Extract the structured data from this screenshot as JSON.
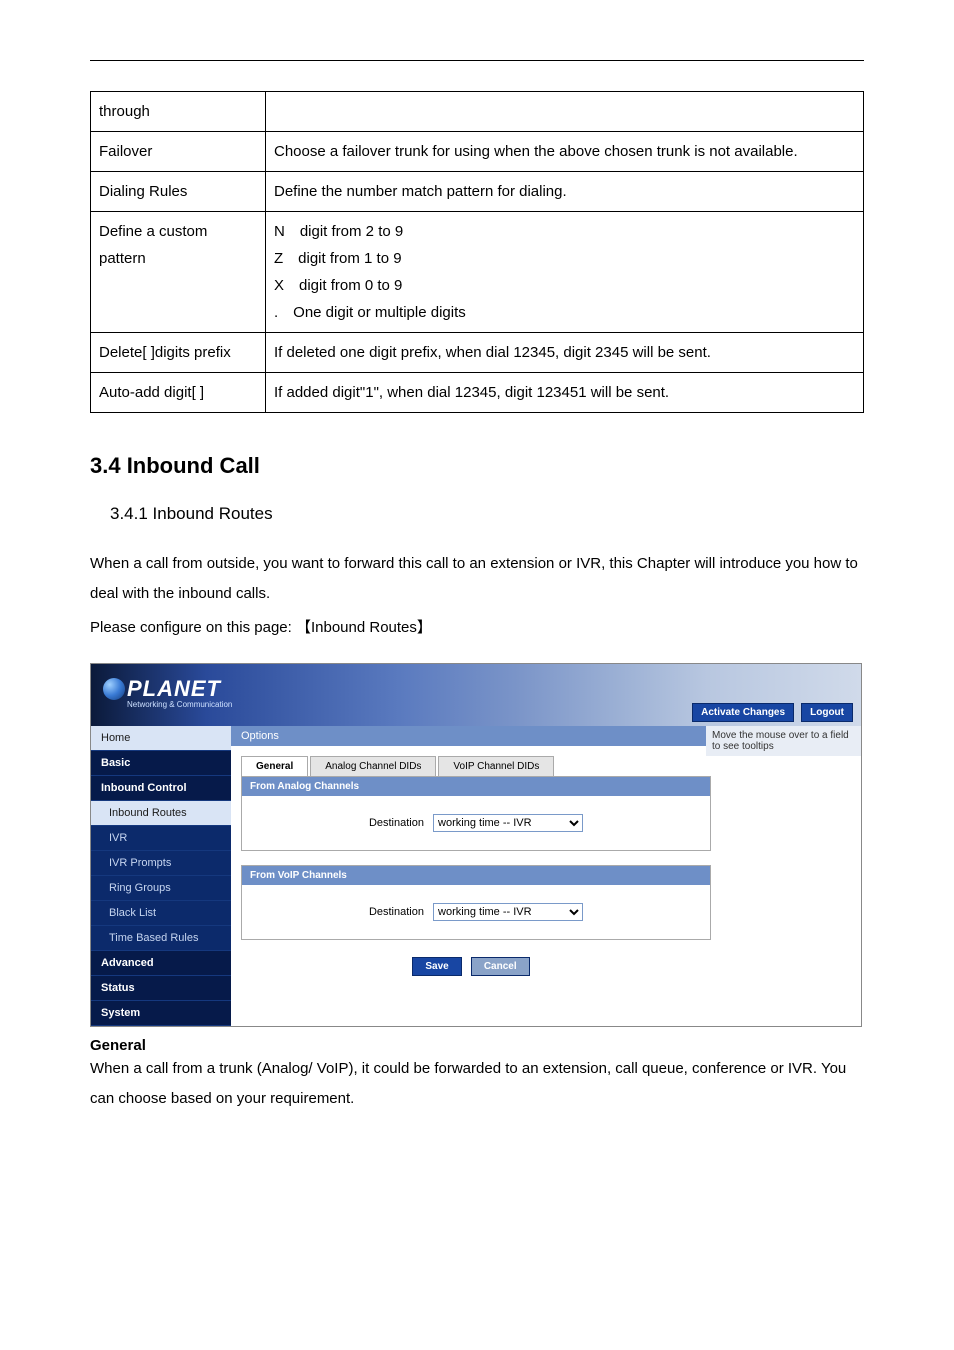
{
  "table": {
    "rows": [
      {
        "c1": "through",
        "c2": ""
      },
      {
        "c1": "Failover",
        "c2": "Choose a failover trunk for using when the above chosen trunk is not available."
      },
      {
        "c1": "Dialing Rules",
        "c2": "Define the number match pattern for dialing."
      },
      {
        "c1": "Define a custom pattern",
        "c2": "N digit from 2 to 9\nZ digit from 1 to 9\nX digit from 0 to 9\n. One digit or multiple digits"
      },
      {
        "c1": "Delete[ ]digits prefix",
        "c2": "If deleted one digit prefix, when dial 12345, digit 2345 will be sent."
      },
      {
        "c1": "Auto-add digit[ ]",
        "c2": "If added digit\"1\", when dial 12345, digit 123451 will be sent."
      }
    ]
  },
  "section_title": "3.4 Inbound Call",
  "subsection_title": "3.4.1 Inbound Routes",
  "para1": "When a call from outside, you want to forward this call to an extension or IVR, this Chapter will introduce you how to deal with the inbound calls.",
  "para2": "Please configure on this page: 【Inbound Routes】",
  "app": {
    "logo_main": "PLANET",
    "logo_sub": "Networking & Communication",
    "btn_activate": "Activate Changes",
    "btn_logout": "Logout",
    "help_text": "Move the mouse over to a field to see tooltips",
    "options_label": "Options",
    "nav": {
      "home": "Home",
      "basic": "Basic",
      "inbound_control": "Inbound Control",
      "inbound_routes": "Inbound Routes",
      "ivr": "IVR",
      "ivr_prompts": "IVR Prompts",
      "ring_groups": "Ring Groups",
      "black_list": "Black List",
      "time_rules": "Time Based Rules",
      "advanced": "Advanced",
      "status": "Status",
      "system": "System"
    },
    "tabs": {
      "general": "General",
      "analog": "Analog Channel DIDs",
      "voip": "VoIP Channel DIDs"
    },
    "panel1_title": "From Analog Channels",
    "panel2_title": "From VoIP Channels",
    "dest_label": "Destination",
    "dest_value": "working time -- IVR",
    "save": "Save",
    "cancel": "Cancel"
  },
  "general_head": "General",
  "general_body": "When a call from a trunk (Analog/ VoIP), it could be forwarded to an extension, call queue, conference or IVR. You can choose based on your requirement."
}
